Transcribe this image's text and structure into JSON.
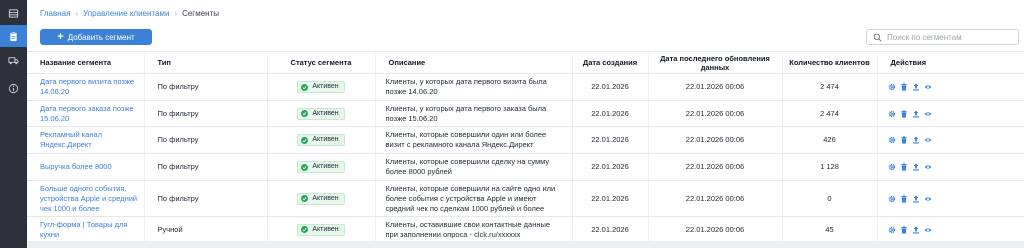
{
  "sidebar": {
    "items": [
      {
        "icon": "table-icon",
        "active": false
      },
      {
        "icon": "clipboard-icon",
        "active": true
      },
      {
        "icon": "truck-icon",
        "active": false
      },
      {
        "icon": "info-icon",
        "active": false
      }
    ]
  },
  "breadcrumb": {
    "home": "Главная",
    "section": "Управление клиентами",
    "current": "Сегменты"
  },
  "toolbar": {
    "add_label": "Добавить сегмент",
    "search_placeholder": "Поиск по сегментам"
  },
  "table": {
    "columns": {
      "name": "Название сегмента",
      "type": "Тип",
      "status": "Статус сегмента",
      "description": "Описание",
      "created": "Дата создания",
      "updated": "Дата последнего обновления данных",
      "count": "Количество клиентов",
      "actions": "Действия"
    },
    "rows": [
      {
        "name": "Дата первого визита позже 14.06.20",
        "type": "По фильтру",
        "status": "Активен",
        "description": "Клиенты, у которых дата первого визита была позже 14.06.20",
        "created": "22.01.2026",
        "updated": "22.01.2026 00:06",
        "count": "2 474"
      },
      {
        "name": "Дата первого заказа позже 15.06.20",
        "type": "По фильтру",
        "status": "Активен",
        "description": "Клиенты, у которых дата первого заказа была позже 15.06.20",
        "created": "22.01.2026",
        "updated": "22.01.2026 00:06",
        "count": "2 474"
      },
      {
        "name": "Рекламный канал Яндекс.Директ",
        "type": "По фильтру",
        "status": "Активен",
        "description": "Клиенты, которые совершили один или более визит с рекламного канала Яндекс.Директ",
        "created": "22.01.2026",
        "updated": "22.01.2026 00:06",
        "count": "426"
      },
      {
        "name": "Выручка более 8000",
        "type": "По фильтру",
        "status": "Активен",
        "description": "Клиенты, которые совершили сделку на сумму более 8000 рублей",
        "created": "22.01.2026",
        "updated": "22.01.2026 00:06",
        "count": "1 128"
      },
      {
        "name": "Больше одного события, устройства Apple и средний чек 1000 и более",
        "type": "По фильтру",
        "status": "Активен",
        "description": "Клиенты, которые совершили на сайте одно или более события с устройства Apple и имеют средний чек по сделкам 1000 рублей и более",
        "created": "22.01.2026",
        "updated": "22.01.2026 00:06",
        "count": "0"
      },
      {
        "name": "Гугл-форма | Товары для кухни",
        "type": "Ручной",
        "status": "Активен",
        "description": "Клиенты, оставившие свои контактные данные при заполнении опроса - clck.ru/xxxxxx",
        "created": "22.01.2026",
        "updated": "22.01.2026 00:06",
        "count": "45"
      }
    ]
  },
  "colors": {
    "accent": "#3b82d6",
    "sidebar_bg": "#2d3139",
    "status_green": "#22a55a"
  }
}
